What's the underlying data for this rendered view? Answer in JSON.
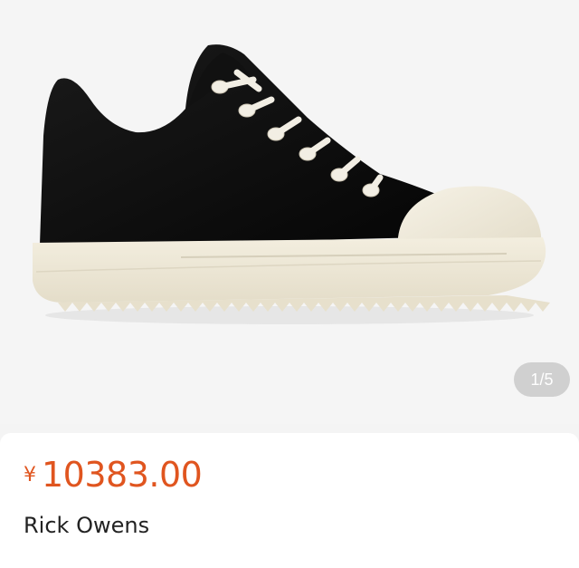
{
  "gallery": {
    "image": "black-suede-low-top-sneaker-with-white-sole",
    "indicator": "1/5"
  },
  "product": {
    "currency_symbol": "¥",
    "price": "10383.00",
    "brand": "Rick Owens"
  },
  "colors": {
    "price": "#e0551f",
    "background": "#f5f5f5",
    "indicator_bg": "#cfcfcf"
  }
}
